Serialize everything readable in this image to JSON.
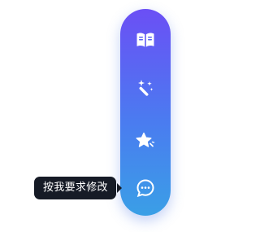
{
  "toolbar": {
    "buttons": [
      {
        "icon": "book-icon"
      },
      {
        "icon": "magic-wand-icon"
      },
      {
        "icon": "star-sparkle-icon"
      },
      {
        "icon": "chat-bubble-icon"
      }
    ],
    "tooltip": "按我要求修改"
  },
  "colors": {
    "gradient_top": "#6b4ff5",
    "gradient_bottom": "#3a9fe6",
    "tooltip_bg": "#161b26",
    "icon": "#ffffff"
  }
}
